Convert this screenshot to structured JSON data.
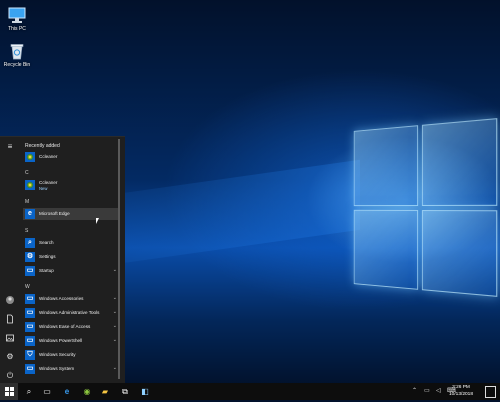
{
  "desktop": {
    "icons": [
      {
        "label": "This PC",
        "icon": "computer-icon"
      },
      {
        "label": "Recycle Bin",
        "icon": "recycle-bin-icon"
      }
    ]
  },
  "start_menu": {
    "sections": {
      "recently_added": "Recently added",
      "c": "C",
      "m": "M",
      "s": "S",
      "w": "W"
    },
    "recent_item": {
      "label": "Ccleaner",
      "icon": "ccleaner-icon"
    },
    "c_item": {
      "label": "Ccleaner",
      "sublabel": "New",
      "icon": "ccleaner-icon"
    },
    "edge_item": {
      "label": "Microsoft Edge",
      "icon": "edge-icon"
    },
    "s_items": [
      {
        "label": "Search",
        "icon": "search-icon"
      },
      {
        "label": "Settings",
        "icon": "gear-icon"
      },
      {
        "label": "Startup",
        "icon": "folder-icon"
      }
    ],
    "w_items": [
      {
        "label": "Windows Accessories",
        "icon": "folder-icon"
      },
      {
        "label": "Windows Administrative Tools",
        "icon": "folder-icon"
      },
      {
        "label": "Windows Ease of Access",
        "icon": "folder-icon"
      },
      {
        "label": "Windows PowerShell",
        "icon": "folder-icon"
      },
      {
        "label": "Windows Security",
        "icon": "shield-icon"
      },
      {
        "label": "Windows System",
        "icon": "folder-icon"
      }
    ],
    "rail_icons": [
      "hamburger-icon",
      "user-icon",
      "document-icon",
      "pictures-icon",
      "gear-icon",
      "power-icon"
    ]
  },
  "taskbar": {
    "buttons": [
      "start-icon",
      "search-icon",
      "task-view-icon",
      "edge-icon",
      "file-explorer-icon",
      "ccleaner-icon",
      "store-icon",
      "app-icon"
    ],
    "time": "3:26 PM",
    "date": "10/13/2018"
  },
  "colors": {
    "accent": "#0a64c8",
    "menu_bg": "#1f1f1f",
    "taskbar_bg": "#0d0d0d"
  }
}
